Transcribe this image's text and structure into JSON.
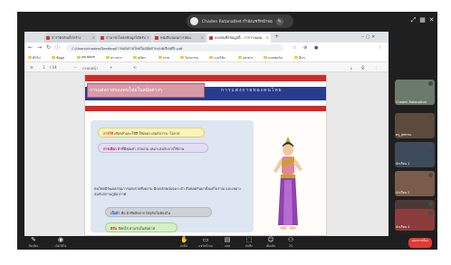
{
  "meeting": {
    "presenter_label": "Chaden Ratanathet กำลังแชร์หน้าจอ",
    "top_icons": [
      "expand-icon",
      "grid-icon",
      "close-icon"
    ],
    "top_right_label": "ประวัติการ"
  },
  "browser": {
    "tabs": [
      {
        "label": "สารวัตรลับเด็กกร้าง",
        "active": false
      },
      {
        "label": "สามารถโหลดข้อมูลได้ครับ",
        "active": false
      },
      {
        "label": "หนังสือ/แผนการสอน",
        "active": false
      },
      {
        "label": "ลองบันทึกข้อมูลนี้ - การวางแผน",
        "active": true
      }
    ],
    "url": "C:/Users/chaden/Desktop/การแต่งกายไทยในสมัยต่างๆ/บทเรียนที่1.pdf",
    "bookmarks": [
      "ทั่วไป",
      "ข้อมูล",
      "youtube",
      "ข่าวสาร",
      "สมัคร",
      "ภาพ",
      "โปรแกรม",
      "งานวิจัย",
      "เอกสาร",
      "แบบฟอร์ม",
      "อื่นๆ"
    ],
    "pdf_tools": {
      "page": "1",
      "total": "/ 14",
      "zoom": "กรอบหน้า"
    }
  },
  "slide": {
    "title": "การแต่งกายของคนไทยในสมัยต่างๆ",
    "script_text": "การแต่งกายของคนไทย",
    "pill1": {
      "label": "การใช้",
      "text": "เลือกผ้าและใช้สี ให้เหมาะสมกับวาระ โอกาส"
    },
    "pill2": {
      "label": "การเลือก",
      "text": "ผ้าที่มีคุณค่า สวยงาม เหมาะสมกับการใช้งาน"
    },
    "paragraph": "คนไทยมีวัฒนธรรมการแต่งกายที่งดงาม มีเอกลักษณ์เฉพาะตัว สืบทอดกันมาตั้งแต่โบราณ และเหมาะสมกับสภาพภูมิอากาศ",
    "pill3": {
      "label": "เนื้อผ้า",
      "text": "คือ ผ้าที่ผลิตจากวัตถุดิบในท้องถิ่น"
    },
    "pill4": {
      "label": "สีสัน",
      "text": "สีสดใส ตามวันในสัปดาห์"
    }
  },
  "participants": [
    {
      "name": "Chaden Ratanathet",
      "bg": "#6b7a6a"
    },
    {
      "name": "ครู_สุพรรณ",
      "bg": "#5c4a3c"
    },
    {
      "name": "นักเรียน 1",
      "bg": "#3d4a5a"
    },
    {
      "name": "นักเรียน 2",
      "bg": "#7a5c4a"
    },
    {
      "name": "นักเรียน 3",
      "bg": "#4a3a36"
    },
    {
      "name": "นักเรียน 4",
      "bg": "#8a3c3c"
    }
  ],
  "toolbar": {
    "items": [
      {
        "icon": "mic-icon",
        "label": "ปิดเสียง"
      },
      {
        "icon": "camera-icon",
        "label": "เปิดวิดีโอ"
      },
      {
        "icon": "hand-icon",
        "label": "ยกมือ"
      },
      {
        "icon": "share-icon",
        "label": "แชร์หน้าจอ"
      },
      {
        "icon": "chat-icon",
        "label": "แชท"
      },
      {
        "icon": "record-icon",
        "label": "บันทึก"
      },
      {
        "icon": "more-icon",
        "label": "เพิ่มเติม"
      },
      {
        "icon": "people-icon",
        "label": "ผู้เข้าร่วม"
      },
      {
        "icon": "participants-count",
        "label": "25"
      }
    ],
    "leave_label": "ออกจากห้อง"
  },
  "colors": {
    "flag_red": "#d62828",
    "flag_blue": "#273c8c",
    "leave_red": "#e53935"
  }
}
